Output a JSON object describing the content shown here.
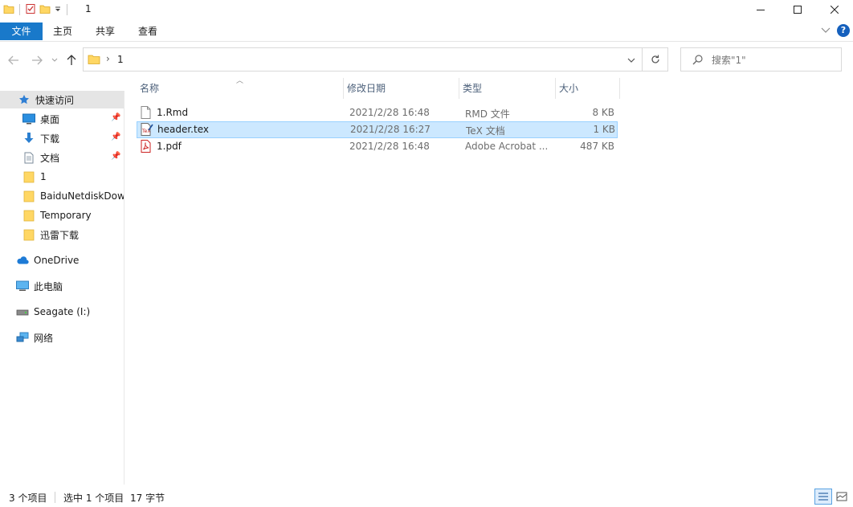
{
  "window": {
    "title": "1"
  },
  "ribbon": {
    "tabs": [
      "文件",
      "主页",
      "共享",
      "查看"
    ],
    "file_color": "#1979ca"
  },
  "address": {
    "path": [
      "1"
    ],
    "search_placeholder": "搜索\"1\""
  },
  "sidebar": {
    "items": [
      {
        "label": "快速访问",
        "icon": "star-icon",
        "pinned": false
      },
      {
        "label": "桌面",
        "icon": "desktop-icon",
        "pinned": true
      },
      {
        "label": "下载",
        "icon": "download-icon",
        "pinned": true
      },
      {
        "label": "文档",
        "icon": "document-icon",
        "pinned": true
      },
      {
        "label": "1",
        "icon": "folder-icon",
        "pinned": false
      },
      {
        "label": "BaiduNetdiskDow",
        "icon": "folder-icon",
        "pinned": false
      },
      {
        "label": "Temporary",
        "icon": "folder-icon",
        "pinned": false
      },
      {
        "label": "迅雷下载",
        "icon": "folder-icon",
        "pinned": false
      },
      {
        "label": "OneDrive",
        "icon": "cloud-icon",
        "pinned": false
      },
      {
        "label": "此电脑",
        "icon": "computer-icon",
        "pinned": false
      },
      {
        "label": "Seagate (I:)",
        "icon": "drive-icon",
        "pinned": false
      },
      {
        "label": "网络",
        "icon": "network-icon",
        "pinned": false
      }
    ]
  },
  "files": {
    "columns": [
      "名称",
      "修改日期",
      "类型",
      "大小"
    ],
    "rows": [
      {
        "name": "1.Rmd",
        "date": "2021/2/28 16:48",
        "type": "RMD 文件",
        "size": "8 KB",
        "icon": "blank-file-icon",
        "selected": false
      },
      {
        "name": "header.tex",
        "date": "2021/2/28 16:27",
        "type": "TeX 文档",
        "size": "1 KB",
        "icon": "tex-file-icon",
        "selected": true
      },
      {
        "name": "1.pdf",
        "date": "2021/2/28 16:48",
        "type": "Adobe Acrobat ...",
        "size": "487 KB",
        "icon": "pdf-file-icon",
        "selected": false
      }
    ]
  },
  "status": {
    "count": "3 个项目",
    "selected": "选中 1 个项目",
    "size": "17 字节"
  }
}
